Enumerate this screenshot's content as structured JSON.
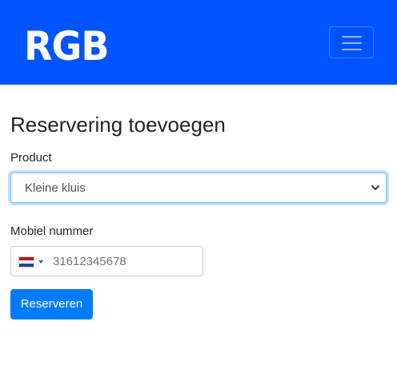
{
  "navbar": {
    "logo_text": "RGB",
    "background_color": "#0054ff",
    "toggler_icon": "hamburger-menu-icon"
  },
  "page": {
    "title": "Reservering toevoegen"
  },
  "form": {
    "product_label": "Product",
    "product_selected": "Kleine kluis",
    "mobile_label": "Mobiel nummer",
    "mobile_placeholder": "31612345678",
    "country_flag": "nl-flag-icon",
    "submit_label": "Reserveren",
    "accent_color": "#007bff"
  }
}
